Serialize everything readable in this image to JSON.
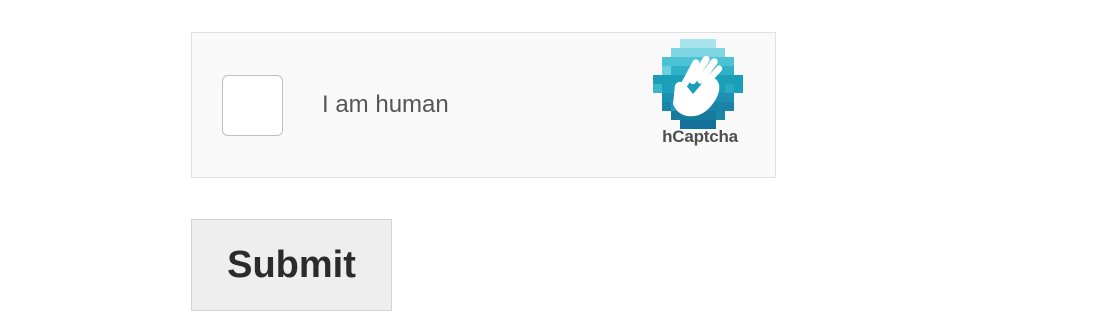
{
  "captcha": {
    "checkbox_checked": false,
    "label": "I am human",
    "brand": "hCaptcha",
    "logo_icon": "hand-wave-icon",
    "colors": {
      "background": "#f9f9f9",
      "logo_light": "#a8e4ee",
      "logo_mid": "#4cc3d4",
      "logo_dark": "#1b9fb8",
      "logo_deep": "#157a9c"
    }
  },
  "form": {
    "submit_label": "Submit"
  }
}
